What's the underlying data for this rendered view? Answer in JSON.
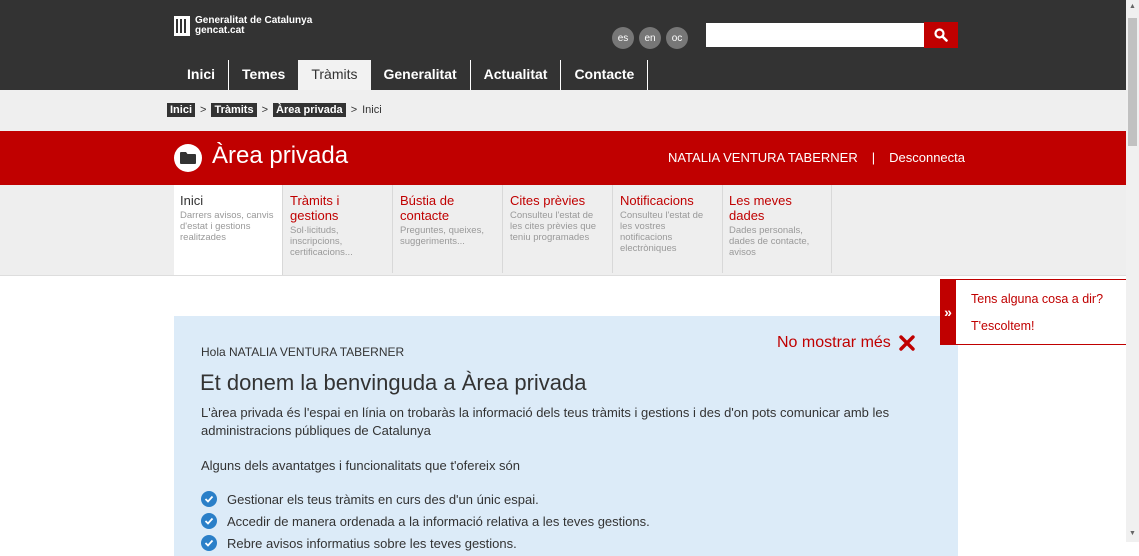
{
  "header": {
    "logo_line1": "Generalitat de Catalunya",
    "logo_line2": "gencat.cat",
    "languages": [
      "es",
      "en",
      "oc"
    ],
    "search_placeholder": "",
    "search_icon": "search-icon",
    "accent_color": "#c00000"
  },
  "nav": {
    "items": [
      "Inici",
      "Temes",
      "Tràmits",
      "Generalitat",
      "Actualitat",
      "Contacte"
    ],
    "active": "Tràmits"
  },
  "breadcrumb": {
    "items": [
      "Inici",
      "Tràmits",
      "Àrea privada"
    ],
    "current": "Inici",
    "separator": ">"
  },
  "area": {
    "icon": "folder-icon",
    "title": "Àrea privada",
    "user_name": "NATALIA VENTURA TABERNER",
    "divider": "|",
    "logout": "Desconnecta"
  },
  "tabs": [
    {
      "title": "Inici",
      "desc": "Darrers avisos, canvis d'estat i gestions realitzades"
    },
    {
      "title": "Tràmits i gestions",
      "desc": "Sol·licituds, inscripcions, certificacions..."
    },
    {
      "title": "Bústia de contacte",
      "desc": "Preguntes, queixes, suggeriments..."
    },
    {
      "title": "Cites prèvies",
      "desc": "Consulteu l'estat de les cites prèvies que teniu programades"
    },
    {
      "title": "Notificacions",
      "desc": "Consulteu l'estat de les vostres notificacions electròniques"
    },
    {
      "title": "Les meves dades",
      "desc": "Dades personals, dades de contacte, avisos"
    }
  ],
  "welcome": {
    "dismiss": "No mostrar més",
    "greeting": "Hola NATALIA VENTURA TABERNER",
    "heading": "Et donem la benvinguda a Àrea privada",
    "intro": "L'àrea privada és l'espai en línia on trobaràs la informació dels teus tràmits i gestions i des d'on pots comunicar amb les administracions públiques de Catalunya",
    "benefits_title": "Alguns dels avantatges i funcionalitats que t'ofereix són",
    "benefits": [
      "Gestionar els teus tràmits en curs des d'un únic espai.",
      "Accedir de manera ordenada a la informació relativa a les teves gestions.",
      "Rebre avisos informatius sobre les teves gestions."
    ]
  },
  "feedback": {
    "toggle": "»",
    "question": "Tens alguna cosa a dir?",
    "link": "T'escoltem!"
  }
}
